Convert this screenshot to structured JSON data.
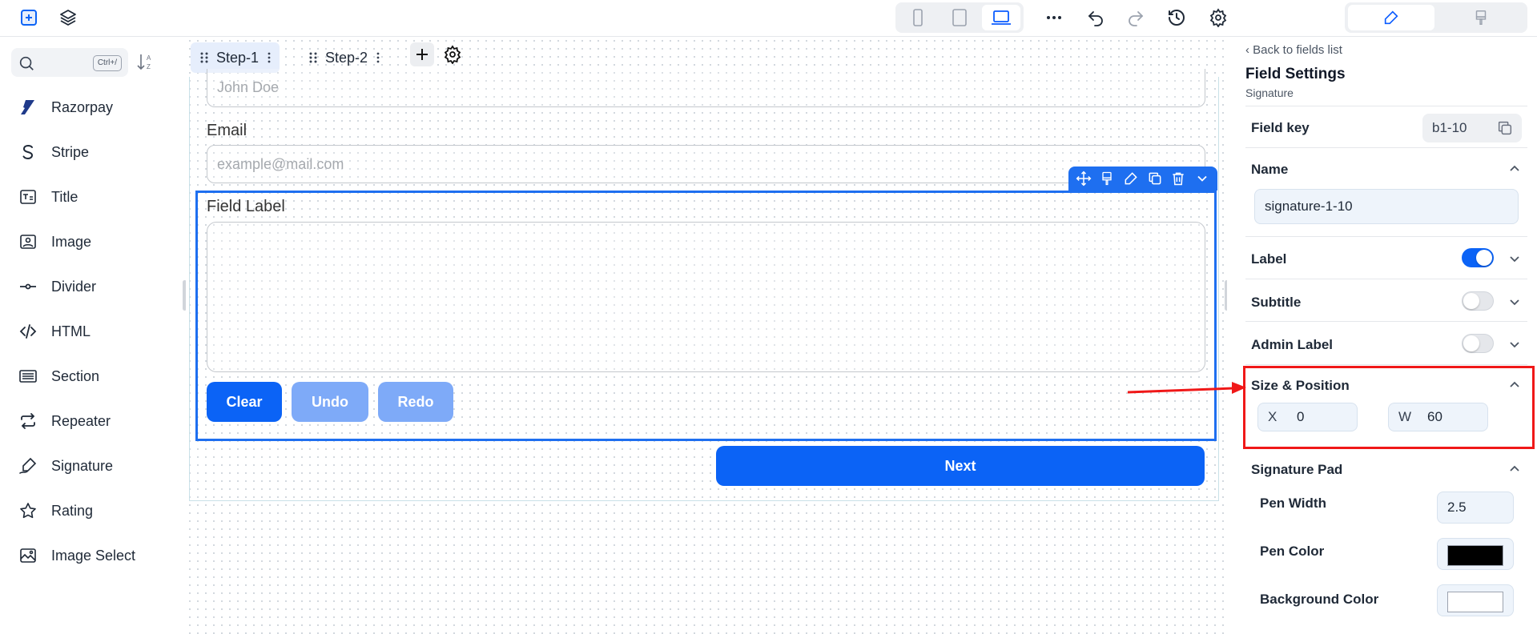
{
  "toolbar": {
    "icons": [
      "add-block-icon",
      "layers-icon",
      "mobile-icon",
      "tablet-icon",
      "laptop-icon",
      "more-icon",
      "undo-icon",
      "redo-icon",
      "history-icon",
      "settings-icon",
      "edit-mode-icon",
      "style-mode-icon"
    ]
  },
  "sidebar": {
    "search": {
      "placeholder": "",
      "shortcut": "Ctrl+/"
    },
    "items": [
      {
        "label": "Razorpay",
        "icon": "razorpay-icon"
      },
      {
        "label": "Stripe",
        "icon": "stripe-icon"
      },
      {
        "label": "Title",
        "icon": "title-icon"
      },
      {
        "label": "Image",
        "icon": "image-icon"
      },
      {
        "label": "Divider",
        "icon": "divider-icon"
      },
      {
        "label": "HTML",
        "icon": "code-icon"
      },
      {
        "label": "Section",
        "icon": "section-icon"
      },
      {
        "label": "Repeater",
        "icon": "repeat-icon"
      },
      {
        "label": "Signature",
        "icon": "signature-icon"
      },
      {
        "label": "Rating",
        "icon": "star-icon"
      },
      {
        "label": "Image Select",
        "icon": "image-select-icon"
      }
    ]
  },
  "canvas": {
    "steps": [
      {
        "label": "Step-1",
        "active": true
      },
      {
        "label": "Step-2",
        "active": false
      }
    ],
    "form": {
      "name_placeholder": "John Doe",
      "email_label": "Email",
      "email_placeholder": "example@mail.com",
      "signature_label": "Field Label",
      "buttons": {
        "clear": "Clear",
        "undo": "Undo",
        "redo": "Redo"
      },
      "next": "Next"
    }
  },
  "panel": {
    "back": "Back to fields list",
    "title": "Field Settings",
    "subtitle": "Signature",
    "field_key_label": "Field key",
    "field_key_value": "b1-10",
    "name_label": "Name",
    "name_value": "signature-1-10",
    "label_label": "Label",
    "label_toggle": true,
    "subtitle_label": "Subtitle",
    "subtitle_toggle": false,
    "admin_label": "Admin Label",
    "admin_toggle": false,
    "size_label": "Size & Position",
    "x_prefix": "X",
    "x_value": "0",
    "w_prefix": "W",
    "w_value": "60",
    "pad_section": "Signature Pad",
    "pen_width_label": "Pen Width",
    "pen_width_value": "2.5",
    "pen_color_label": "Pen Color",
    "pen_color_value": "#000000",
    "bg_color_label": "Background Color",
    "bg_color_value": "#ffffff"
  },
  "colors": {
    "accent": "#0b63f6",
    "selection": "#1e6ff0",
    "highlight": "#f01818",
    "disabled_button": "#7eaaf8"
  }
}
